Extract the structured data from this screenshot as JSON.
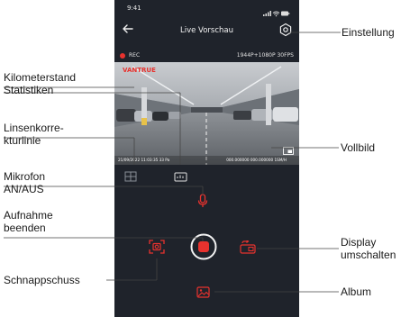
{
  "status_bar": {
    "time": "9:41"
  },
  "header": {
    "title": "Live Vorschau"
  },
  "recording": {
    "indicator": "REC",
    "resolution": "1944P+1080P 30FPS"
  },
  "video": {
    "watermark": "VANTRUE",
    "date": "21/09/2022 11:03:35 33 Pa",
    "coords": "000.000000 000.000000 1SM/H"
  },
  "callouts": {
    "einstellung": "Einstellung",
    "kilometerstand": [
      "Kilometerstand",
      "Statistiken"
    ],
    "linsenkorrektur": [
      "Linsenkorre-",
      "kturlinie"
    ],
    "vollbild": "Vollbild",
    "mikrofon": [
      "Mikrofon",
      "AN/AUS"
    ],
    "aufnahme": [
      "Aufnahme",
      "beenden"
    ],
    "display": [
      "Display",
      "umschalten"
    ],
    "schnappschuss": "Schnappschuss",
    "album": "Album"
  },
  "colors": {
    "accent": "#e8322e",
    "phone_bg": "#1f232b"
  }
}
